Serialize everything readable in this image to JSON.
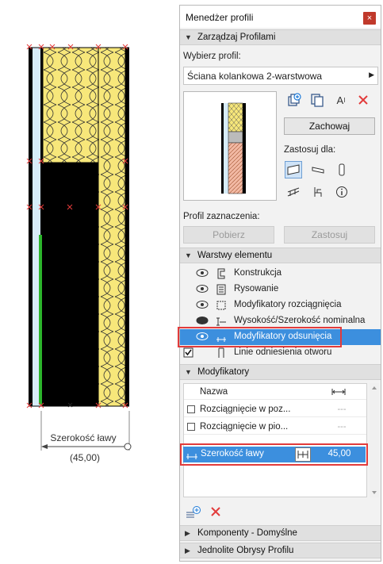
{
  "drawing": {
    "dimension_label": "Szerokość ławy",
    "dimension_value": "(45,00)"
  },
  "panel": {
    "title": "Menedżer profili",
    "close_label": "×",
    "manage_section": "Zarządzaj Profilami",
    "choose_profile_label": "Wybierz profil:",
    "profile_value": "Ściana kolankowa 2-warstwowa",
    "save_label": "Zachowaj",
    "apply_for_label": "Zastosuj dla:",
    "selection_profile_label": "Profil zaznaczenia:",
    "get_label": "Pobierz",
    "apply_label": "Zastosuj",
    "layers_section": "Warstwy elementu",
    "layers": [
      {
        "label": "Konstrukcja"
      },
      {
        "label": "Rysowanie"
      },
      {
        "label": "Modyfikatory rozciągnięcia"
      },
      {
        "label": "Wysokość/Szerokość nominalna"
      },
      {
        "label": "Modyfikatory odsunięcia"
      },
      {
        "label": "Linie odniesienia otworu"
      }
    ],
    "modifiers_section": "Modyfikatory",
    "modifiers_header": "Nazwa",
    "modifiers": [
      {
        "name": "Rozciągnięcie w poz...",
        "value": "---"
      },
      {
        "name": "Rozciągnięcie w pio...",
        "value": "---"
      }
    ],
    "selected_modifier": {
      "name": "Szerokość ławy",
      "value": "45,00"
    },
    "components_section": "Komponenty - Domyślne",
    "outlines_section": "Jednolite Obrysy Profilu"
  },
  "colors": {
    "insulation": "#f7e77a",
    "selection_blue": "#3c8fde",
    "highlight_red": "#e23b3b",
    "green_line": "#2bb52b"
  }
}
